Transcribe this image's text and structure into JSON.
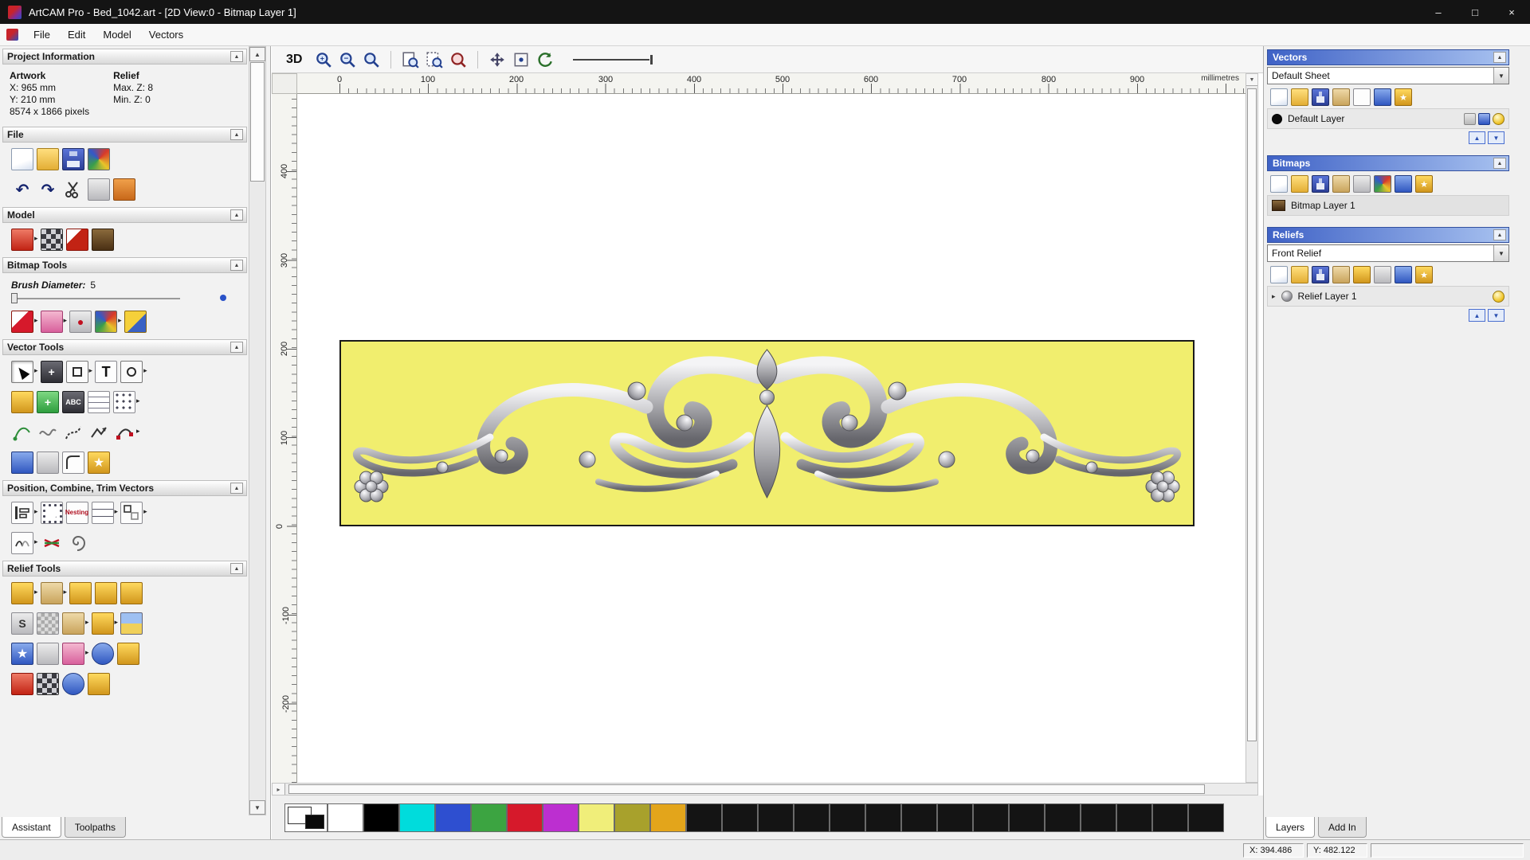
{
  "window": {
    "title": "ArtCAM Pro - Bed_1042.art - [2D View:0 - Bitmap Layer 1]",
    "controls": {
      "minimize": "–",
      "maximize": "□",
      "close": "×"
    }
  },
  "menu": {
    "items": {
      "file": "File",
      "edit": "Edit",
      "model": "Model",
      "vectors": "Vectors"
    }
  },
  "assistant": {
    "project_information": {
      "title": "Project Information",
      "artwork_label": "Artwork",
      "relief_label": "Relief",
      "x": "X: 965 mm",
      "y": "Y: 210 mm",
      "max_z": "Max. Z: 8",
      "min_z": "Min. Z: 0",
      "pixels": "8574 x 1866 pixels"
    },
    "file_section_title": "File",
    "model_section_title": "Model",
    "bitmap_tools_title": "Bitmap Tools",
    "brush_diameter_label": "Brush Diameter:",
    "brush_diameter_value": "5",
    "vector_tools_title": "Vector Tools",
    "position_section_title": "Position, Combine, Trim Vectors",
    "relief_tools_title": "Relief Tools",
    "tabs": {
      "assistant": "Assistant",
      "toolpaths": "Toolpaths"
    }
  },
  "toolbar": {
    "view_3d": "3D"
  },
  "ruler": {
    "unit": "millimetres",
    "h": [
      "0",
      "100",
      "200",
      "300",
      "400",
      "500",
      "600",
      "700",
      "800",
      "900"
    ],
    "v": [
      "400",
      "300",
      "200",
      "100",
      "0",
      "-100",
      "-200"
    ]
  },
  "right_panel": {
    "vectors": {
      "title": "Vectors",
      "sheet": "Default Sheet",
      "layer": "Default Layer"
    },
    "bitmaps": {
      "title": "Bitmaps",
      "layer": "Bitmap Layer 1"
    },
    "reliefs": {
      "title": "Reliefs",
      "selected": "Front Relief",
      "layer": "Relief Layer 1"
    },
    "tabs": {
      "layers": "Layers",
      "addin": "Add In"
    }
  },
  "status": {
    "x": "X: 394.486",
    "y": "Y: 482.122"
  },
  "colors": {
    "artwork_fill": "#f1ee6e",
    "panel_header_blue": "#3f62c6",
    "titlebar": "#141414"
  },
  "palette": {
    "colors": [
      "#ffffff",
      "#000000",
      "#00dcdc",
      "#2e4fd0",
      "#3ca441",
      "#d6192b",
      "#bc2fd0",
      "#f0ee7a",
      "#a8a12c",
      "#e3a51b",
      "#141414",
      "#141414",
      "#141414",
      "#141414",
      "#141414",
      "#141414",
      "#141414",
      "#141414",
      "#141414",
      "#141414",
      "#141414",
      "#141414",
      "#141414",
      "#141414",
      "#141414"
    ]
  },
  "glyphs": {
    "up": "▲",
    "down": "▼",
    "right": "▸",
    "undo": "↶",
    "redo": "↷",
    "plus": "+",
    "minus": "−",
    "text_tool": "T",
    "abc": "ABC",
    "star": "★",
    "s": "S",
    "nesting": "Nesting",
    "dot": "●"
  }
}
